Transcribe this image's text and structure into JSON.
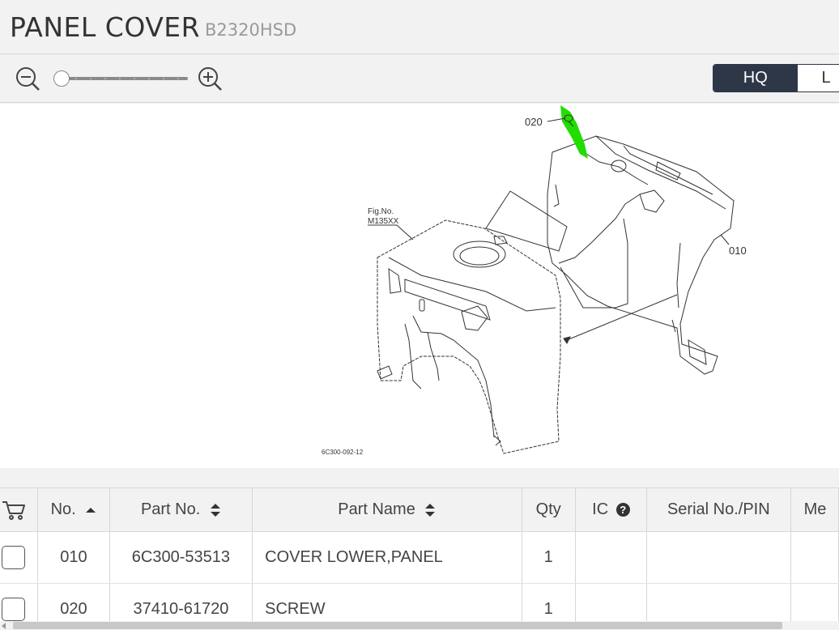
{
  "header": {
    "title": "PANEL COVER",
    "model": "B2320HSD"
  },
  "toolbar": {
    "zoom_out_icon": "zoom-out-icon",
    "zoom_in_icon": "zoom-in-icon",
    "zoom_level": 0,
    "quality": {
      "hq_label": "HQ",
      "lq_label": "L",
      "selected": "HQ"
    }
  },
  "diagram": {
    "fig_no_label": "Fig.No.",
    "fig_no": "M135XX",
    "callout_020": "020",
    "callout_010": "010",
    "drawing_id": "6C300-092-12",
    "highlight_color": "#22dd00"
  },
  "table": {
    "headers": {
      "cart": "cart-icon",
      "no": "No.",
      "part_no": "Part No.",
      "part_name": "Part Name",
      "qty": "Qty",
      "ic": "IC",
      "serial": "Serial No./PIN",
      "memo": "Me"
    },
    "rows": [
      {
        "no": "010",
        "part_no": "6C300-53513",
        "part_name": "COVER LOWER,PANEL",
        "qty": "1",
        "ic": "",
        "serial": ""
      },
      {
        "no": "020",
        "part_no": "37410-61720",
        "part_name": "SCREW",
        "qty": "1",
        "ic": "",
        "serial": ""
      }
    ]
  }
}
